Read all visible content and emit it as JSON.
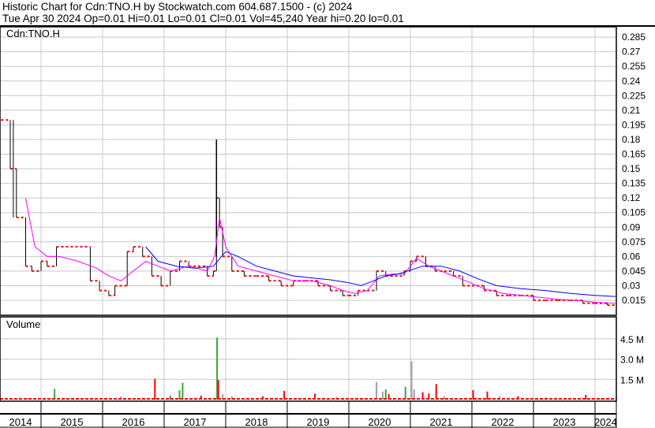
{
  "header": {
    "title": "Historic Chart for Cdn:TNO.H by Stockwatch.com 604.687.1500 - (c) 2024",
    "quote": "Tue Apr 30 2024  Op=0.01  Hi=0.01  Lo=0.01  Cl=0.01  Vol=45,240  Year hi=0.20  lo=0.01"
  },
  "colors": {
    "price": "#000000",
    "close_tick": "#ff0000",
    "ma_long": "#0000ff",
    "ma_short": "#ff00ff",
    "vol_up": "#33aa33",
    "vol_down": "#ff0000",
    "vol_flat": "#a0a0a0",
    "grid": "#c8c8c8"
  },
  "chart_data": [
    {
      "type": "line",
      "title": "Cdn:TNO.H",
      "ylim": [
        0,
        0.295
      ],
      "yticks": [
        "0.285",
        "0.27",
        "0.255",
        "0.24",
        "0.225",
        "0.21",
        "0.195",
        "0.18",
        "0.165",
        "0.15",
        "0.135",
        "0.12",
        "0.105",
        "0.09",
        "0.075",
        "0.06",
        "0.045",
        "0.03",
        "0.015"
      ],
      "xticks": [
        "2014",
        "2015",
        "2016",
        "2017",
        "2018",
        "2019",
        "2020",
        "2021",
        "2022",
        "2023",
        "2024"
      ],
      "x_start_year": 2014.35,
      "series": [
        {
          "name": "close",
          "x": [
            2014.35,
            2014.5,
            2014.6,
            2014.75,
            2014.85,
            2015.0,
            2015.1,
            2015.25,
            2015.8,
            2015.95,
            2016.1,
            2016.2,
            2016.4,
            2016.5,
            2016.65,
            2016.8,
            2016.95,
            2017.1,
            2017.25,
            2017.4,
            2017.55,
            2017.7,
            2017.8,
            2017.85,
            2017.9,
            2017.95,
            2018.1,
            2018.3,
            2018.5,
            2018.7,
            2018.9,
            2019.1,
            2019.3,
            2019.5,
            2019.7,
            2019.9,
            2020.0,
            2020.15,
            2020.3,
            2020.45,
            2020.6,
            2020.75,
            2020.9,
            2021.0,
            2021.1,
            2021.25,
            2021.4,
            2021.55,
            2021.7,
            2021.85,
            2022.0,
            2022.2,
            2022.4,
            2022.6,
            2022.8,
            2023.0,
            2023.2,
            2023.4,
            2023.6,
            2023.8,
            2024.0,
            2024.2,
            2024.33
          ],
          "values": [
            0.2,
            0.15,
            0.1,
            0.05,
            0.045,
            0.055,
            0.05,
            0.07,
            0.035,
            0.025,
            0.02,
            0.03,
            0.065,
            0.07,
            0.06,
            0.04,
            0.03,
            0.045,
            0.055,
            0.05,
            0.05,
            0.04,
            0.045,
            0.12,
            0.09,
            0.06,
            0.045,
            0.04,
            0.04,
            0.035,
            0.03,
            0.035,
            0.035,
            0.03,
            0.025,
            0.02,
            0.02,
            0.025,
            0.025,
            0.045,
            0.04,
            0.04,
            0.045,
            0.055,
            0.06,
            0.05,
            0.045,
            0.045,
            0.04,
            0.03,
            0.03,
            0.025,
            0.02,
            0.02,
            0.02,
            0.015,
            0.015,
            0.015,
            0.015,
            0.012,
            0.012,
            0.01,
            0.01
          ]
        },
        {
          "name": "ma_short",
          "x": [
            2014.75,
            2014.9,
            2015.1,
            2015.3,
            2015.6,
            2015.9,
            2016.1,
            2016.3,
            2016.5,
            2016.7,
            2016.9,
            2017.1,
            2017.4,
            2017.7,
            2017.82,
            2017.9,
            2018.0,
            2018.2,
            2018.5,
            2018.8,
            2019.1,
            2019.4,
            2019.7,
            2019.9,
            2020.1,
            2020.3,
            2020.5,
            2020.7,
            2020.9,
            2021.1,
            2021.3,
            2021.5,
            2021.7,
            2021.9,
            2022.2,
            2022.5,
            2022.8,
            2023.1,
            2023.4,
            2023.7,
            2024.0,
            2024.33
          ],
          "values": [
            0.12,
            0.07,
            0.06,
            0.06,
            0.055,
            0.048,
            0.04,
            0.035,
            0.045,
            0.055,
            0.05,
            0.045,
            0.05,
            0.045,
            0.06,
            0.1,
            0.07,
            0.05,
            0.045,
            0.04,
            0.035,
            0.035,
            0.03,
            0.025,
            0.022,
            0.025,
            0.04,
            0.042,
            0.042,
            0.058,
            0.05,
            0.045,
            0.04,
            0.035,
            0.027,
            0.022,
            0.02,
            0.018,
            0.016,
            0.015,
            0.013,
            0.012
          ]
        },
        {
          "name": "ma_long",
          "x": [
            2016.7,
            2016.9,
            2017.2,
            2017.5,
            2017.8,
            2018.0,
            2018.2,
            2018.5,
            2018.8,
            2019.1,
            2019.4,
            2019.7,
            2020.0,
            2020.2,
            2020.4,
            2020.6,
            2020.8,
            2021.0,
            2021.2,
            2021.5,
            2021.8,
            2022.1,
            2022.4,
            2022.8,
            2023.2,
            2023.6,
            2024.0,
            2024.33
          ],
          "values": [
            0.07,
            0.055,
            0.05,
            0.048,
            0.05,
            0.065,
            0.06,
            0.05,
            0.045,
            0.04,
            0.038,
            0.036,
            0.033,
            0.03,
            0.035,
            0.04,
            0.042,
            0.046,
            0.05,
            0.05,
            0.045,
            0.037,
            0.03,
            0.027,
            0.025,
            0.022,
            0.02,
            0.019
          ]
        }
      ]
    },
    {
      "type": "bar",
      "title": "Volume",
      "ylim": [
        0,
        5500000
      ],
      "yticks": [
        "4.5 M",
        "3.0 M",
        "1.5 M"
      ],
      "ytick_values": [
        4500000,
        3000000,
        1500000
      ],
      "bars": [
        {
          "x": 2014.9,
          "v": 100000,
          "c": "down"
        },
        {
          "x": 2015.22,
          "v": 800000,
          "c": "up"
        },
        {
          "x": 2016.3,
          "v": 250000,
          "c": "flat"
        },
        {
          "x": 2016.85,
          "v": 1550000,
          "c": "down"
        },
        {
          "x": 2017.1,
          "v": 300000,
          "c": "up"
        },
        {
          "x": 2017.25,
          "v": 700000,
          "c": "up"
        },
        {
          "x": 2017.3,
          "v": 1250000,
          "c": "up"
        },
        {
          "x": 2017.6,
          "v": 300000,
          "c": "down"
        },
        {
          "x": 2017.86,
          "v": 4600000,
          "c": "up"
        },
        {
          "x": 2017.88,
          "v": 1450000,
          "c": "down"
        },
        {
          "x": 2017.95,
          "v": 400000,
          "c": "flat"
        },
        {
          "x": 2018.1,
          "v": 250000,
          "c": "flat"
        },
        {
          "x": 2018.6,
          "v": 250000,
          "c": "down"
        },
        {
          "x": 2018.95,
          "v": 650000,
          "c": "down"
        },
        {
          "x": 2019.45,
          "v": 450000,
          "c": "down"
        },
        {
          "x": 2019.8,
          "v": 200000,
          "c": "flat"
        },
        {
          "x": 2020.45,
          "v": 1300000,
          "c": "flat"
        },
        {
          "x": 2020.55,
          "v": 600000,
          "c": "flat"
        },
        {
          "x": 2020.6,
          "v": 750000,
          "c": "up"
        },
        {
          "x": 2020.65,
          "v": 400000,
          "c": "down"
        },
        {
          "x": 2020.92,
          "v": 950000,
          "c": "up"
        },
        {
          "x": 2021.02,
          "v": 2850000,
          "c": "flat"
        },
        {
          "x": 2021.06,
          "v": 750000,
          "c": "flat"
        },
        {
          "x": 2021.2,
          "v": 550000,
          "c": "down"
        },
        {
          "x": 2021.3,
          "v": 450000,
          "c": "down"
        },
        {
          "x": 2021.42,
          "v": 1150000,
          "c": "down"
        },
        {
          "x": 2021.55,
          "v": 250000,
          "c": "flat"
        },
        {
          "x": 2022.02,
          "v": 700000,
          "c": "down"
        },
        {
          "x": 2022.25,
          "v": 600000,
          "c": "down"
        },
        {
          "x": 2022.45,
          "v": 250000,
          "c": "flat"
        },
        {
          "x": 2022.75,
          "v": 250000,
          "c": "down"
        },
        {
          "x": 2023.2,
          "v": 150000,
          "c": "up"
        },
        {
          "x": 2023.85,
          "v": 350000,
          "c": "down"
        },
        {
          "x": 2024.1,
          "v": 100000,
          "c": "up"
        }
      ]
    }
  ]
}
